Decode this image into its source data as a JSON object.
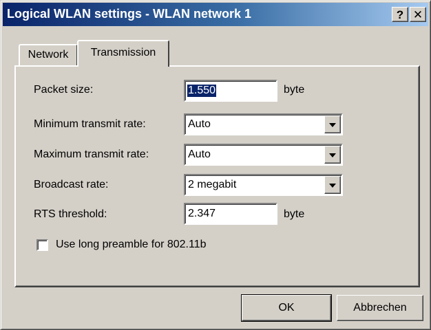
{
  "window": {
    "title": "Logical WLAN settings - WLAN network 1"
  },
  "titlebar": {
    "help_label": "?",
    "close_label": "✕"
  },
  "tabs": [
    {
      "label": "Network"
    },
    {
      "label": "Transmission"
    }
  ],
  "form": {
    "packet_size": {
      "label": "Packet size:",
      "value": "1.550",
      "unit": "byte"
    },
    "min_rate": {
      "label": "Minimum transmit rate:",
      "value": "Auto"
    },
    "max_rate": {
      "label": "Maximum transmit rate:",
      "value": "Auto"
    },
    "broadcast_rate": {
      "label": "Broadcast rate:",
      "value": "2 megabit"
    },
    "rts_threshold": {
      "label": "RTS threshold:",
      "value": "2.347",
      "unit": "byte"
    },
    "long_preamble": {
      "label": "Use long preamble for 802.11b",
      "checked": false
    }
  },
  "buttons": {
    "ok_label": "OK",
    "cancel_label": "Abbrechen"
  },
  "colors": {
    "title_start": "#0a246a",
    "title_end": "#a6caf0",
    "face": "#d4d0c8"
  }
}
